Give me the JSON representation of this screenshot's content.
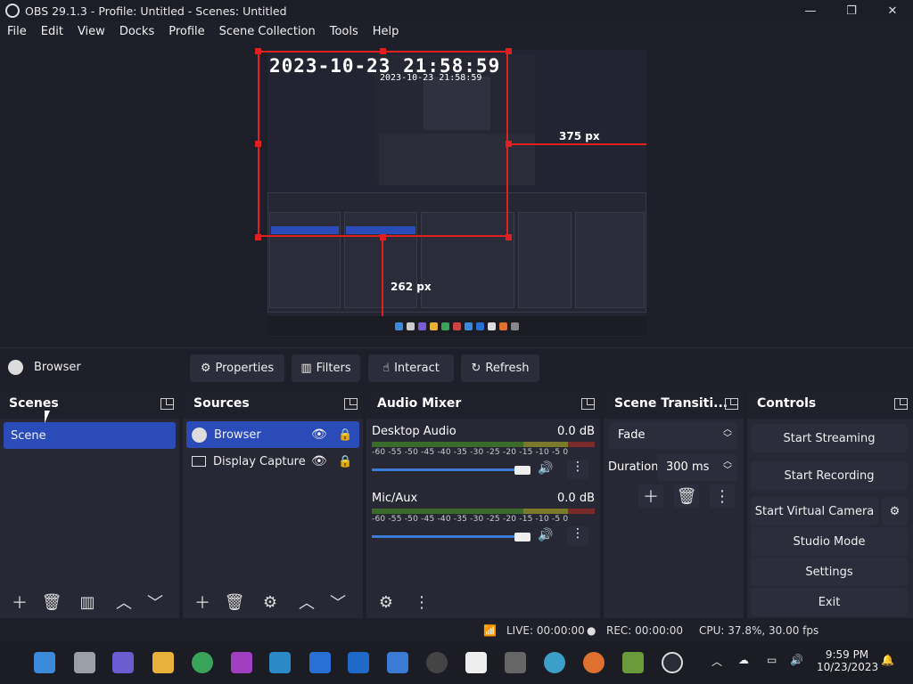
{
  "window": {
    "title": "OBS 29.1.3 - Profile: Untitled - Scenes: Untitled",
    "minimize": "—",
    "maximize": "❐",
    "close": "✕"
  },
  "menu": [
    "File",
    "Edit",
    "View",
    "Docks",
    "Profile",
    "Scene Collection",
    "Tools",
    "Help"
  ],
  "preview": {
    "timestamp": "2023-10-23 21:58:59",
    "timestamp_small": "2023-10-23 21:58:59",
    "label_right": "375 px",
    "label_bottom": "262 px"
  },
  "source_toolbar": {
    "source_name": "Browser",
    "properties": "Properties",
    "filters": "Filters",
    "interact": "Interact",
    "refresh": "Refresh"
  },
  "scenes": {
    "title": "Scenes",
    "items": [
      "Scene"
    ]
  },
  "sources": {
    "title": "Sources",
    "items": [
      "Browser",
      "Display Capture"
    ]
  },
  "audio": {
    "title": "Audio Mixer",
    "channels": [
      {
        "name": "Desktop Audio",
        "level": "0.0 dB",
        "volume": 1.0
      },
      {
        "name": "Mic/Aux",
        "level": "0.0 dB",
        "volume": 1.0
      }
    ],
    "scale": "-60 -55 -50 -45 -40 -35 -30 -25 -20 -15 -10 -5  0"
  },
  "transitions": {
    "title": "Scene Transiti...",
    "selected": "Fade",
    "duration_label": "Duration",
    "duration_value": "300 ms"
  },
  "controls": {
    "title": "Controls",
    "start_streaming": "Start Streaming",
    "start_recording": "Start Recording",
    "start_virtual_camera": "Start Virtual Camera",
    "studio_mode": "Studio Mode",
    "settings": "Settings",
    "exit": "Exit"
  },
  "status": {
    "live": "LIVE: 00:00:00",
    "rec": "REC: 00:00:00",
    "cpu": "CPU: 37.8%, 30.00 fps"
  },
  "taskbar": {
    "time": "9:59 PM",
    "date": "10/23/2023"
  }
}
